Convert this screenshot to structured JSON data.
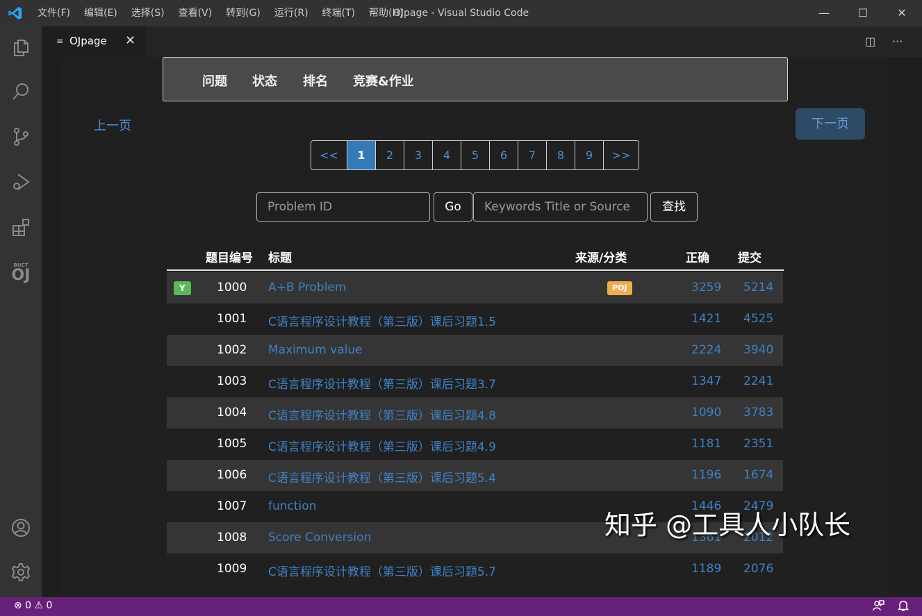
{
  "titlebar": {
    "menu": [
      "文件(F)",
      "编辑(E)",
      "选择(S)",
      "查看(V)",
      "转到(G)",
      "运行(R)",
      "终端(T)",
      "帮助(H)"
    ],
    "window_title": "OJpage - Visual Studio Code",
    "controls": {
      "minimize": "—",
      "maximize": "☐",
      "close": "✕"
    }
  },
  "activitybar": {
    "items": [
      "files-icon",
      "search-icon",
      "source-control-icon",
      "run-debug-icon",
      "extensions-icon",
      "oj-extension-icon",
      "account-icon",
      "settings-gear-icon"
    ],
    "oj_small": "BUCT",
    "oj_big": "OJ"
  },
  "tab": {
    "icon": "≡",
    "label": "OJpage",
    "close": "✕"
  },
  "tab_actions": {
    "split": "◫",
    "more": "···"
  },
  "navbar": {
    "items": [
      "问题",
      "状态",
      "排名",
      "竞赛&作业"
    ]
  },
  "paging": {
    "prev_label": "上一页",
    "next_label": "下一页",
    "pages": [
      "<<",
      "1",
      "2",
      "3",
      "4",
      "5",
      "6",
      "7",
      "8",
      "9",
      ">>"
    ],
    "active_page": "1"
  },
  "search": {
    "problem_id_placeholder": "Problem ID",
    "go_label": "Go",
    "keywords_placeholder": "Keywords Title or Source",
    "find_label": "查找"
  },
  "table": {
    "headers": {
      "id": "题目编号",
      "title": "标题",
      "source": "来源/分类",
      "accepted": "正确",
      "submitted": "提交"
    },
    "rows": [
      {
        "badge": "Y",
        "id": "1000",
        "title": "A+B Problem",
        "source": "POJ",
        "accepted": "3259",
        "submitted": "5214"
      },
      {
        "badge": "",
        "id": "1001",
        "title": "C语言程序设计教程（第三版）课后习题1.5",
        "source": "",
        "accepted": "1421",
        "submitted": "4525"
      },
      {
        "badge": "",
        "id": "1002",
        "title": "Maximum value",
        "source": "",
        "accepted": "2224",
        "submitted": "3940"
      },
      {
        "badge": "",
        "id": "1003",
        "title": "C语言程序设计教程（第三版）课后习题3.7",
        "source": "",
        "accepted": "1347",
        "submitted": "2241"
      },
      {
        "badge": "",
        "id": "1004",
        "title": "C语言程序设计教程（第三版）课后习题4.8",
        "source": "",
        "accepted": "1090",
        "submitted": "3783"
      },
      {
        "badge": "",
        "id": "1005",
        "title": "C语言程序设计教程（第三版）课后习题4.9",
        "source": "",
        "accepted": "1181",
        "submitted": "2351"
      },
      {
        "badge": "",
        "id": "1006",
        "title": "C语言程序设计教程（第三版）课后习题5.4",
        "source": "",
        "accepted": "1196",
        "submitted": "1674"
      },
      {
        "badge": "",
        "id": "1007",
        "title": "function",
        "source": "",
        "accepted": "1446",
        "submitted": "2479"
      },
      {
        "badge": "",
        "id": "1008",
        "title": "Score Conversion",
        "source": "",
        "accepted": "1361",
        "submitted": "2012"
      },
      {
        "badge": "",
        "id": "1009",
        "title": "C语言程序设计教程（第三版）课后习题5.7",
        "source": "",
        "accepted": "1189",
        "submitted": "2076"
      }
    ]
  },
  "watermark": "知乎 @工具人小队长",
  "statusbar": {
    "errors": "⊗ 0",
    "warnings": "⚠ 0",
    "feedback_icon": "feedback-icon",
    "bell_icon": "bell-icon"
  },
  "colors": {
    "statusbar": "#68217a",
    "link": "#3f80c4",
    "active_page": "#337ab7",
    "badge_yes": "#5cb85c",
    "badge_source": "#f0ad4e"
  }
}
